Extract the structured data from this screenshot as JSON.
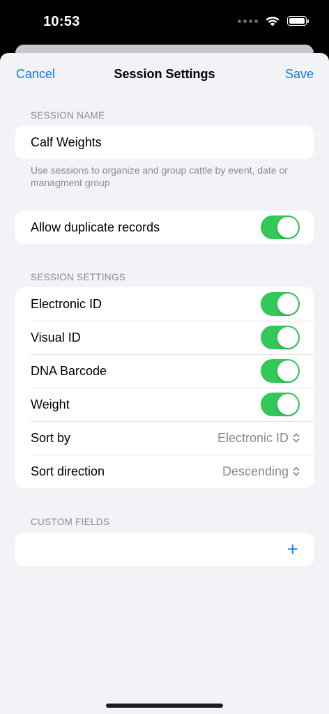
{
  "status_bar": {
    "time": "10:53"
  },
  "nav": {
    "cancel_label": "Cancel",
    "title": "Session Settings",
    "save_label": "Save"
  },
  "session_name": {
    "header": "SESSION NAME",
    "value": "Calf Weights",
    "footer": "Use sessions to organize and group cattle by event, date or managment group"
  },
  "duplicates": {
    "label": "Allow duplicate records",
    "enabled": true
  },
  "session_settings": {
    "header": "SESSION SETTINGS",
    "toggles": [
      {
        "label": "Electronic ID",
        "enabled": true
      },
      {
        "label": "Visual ID",
        "enabled": true
      },
      {
        "label": "DNA Barcode",
        "enabled": true
      },
      {
        "label": "Weight",
        "enabled": true
      }
    ],
    "sort_by": {
      "label": "Sort by",
      "value": "Electronic ID"
    },
    "sort_direction": {
      "label": "Sort direction",
      "value": "Descending"
    }
  },
  "custom_fields": {
    "header": "CUSTOM FIELDS",
    "add_symbol": "+"
  },
  "colors": {
    "accent": "#0a7aff",
    "toggle_on": "#34c759",
    "background": "#f2f2f7"
  }
}
